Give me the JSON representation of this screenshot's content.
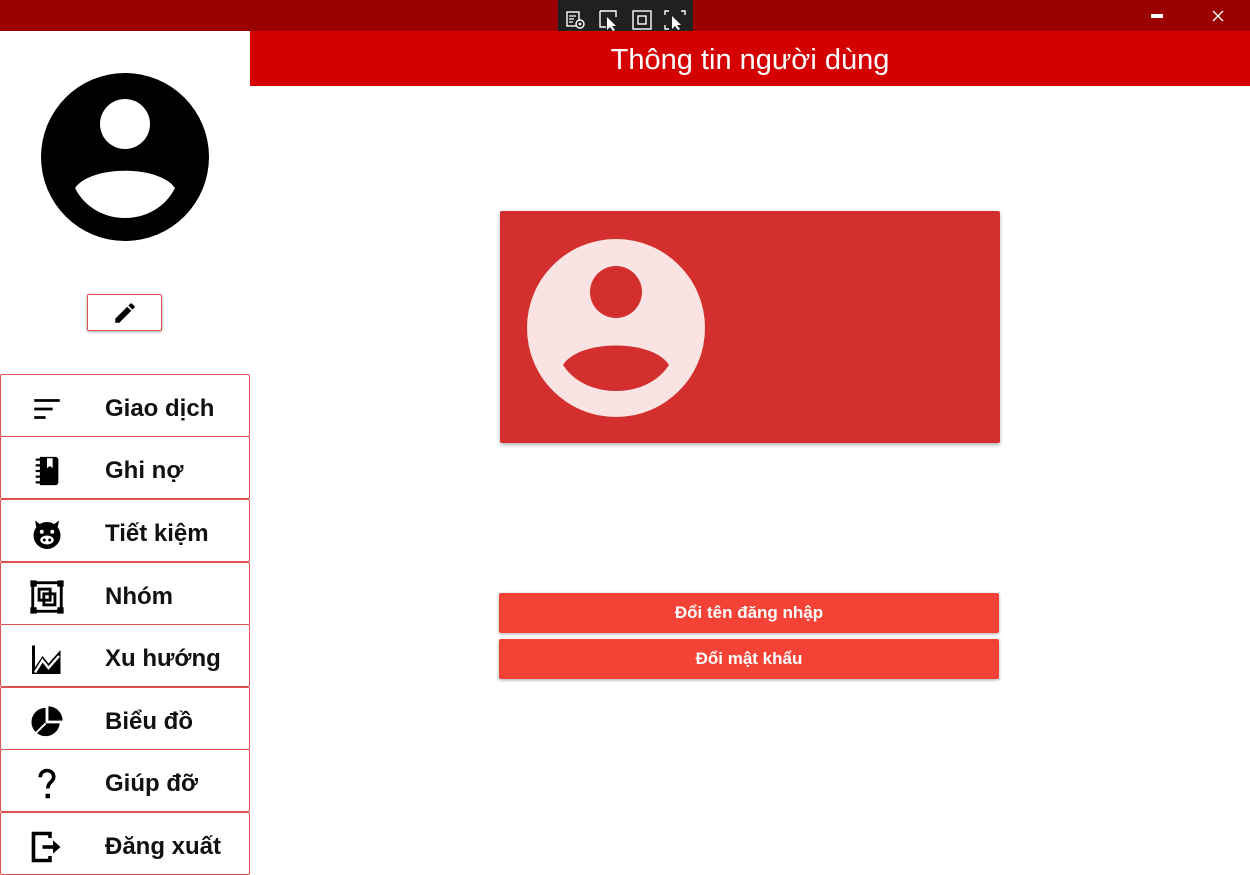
{
  "window": {
    "minimize_icon": "minimize-icon",
    "close_icon": "close-icon",
    "titlebar_color": "#9b0000"
  },
  "devtools": {
    "icons": [
      "live-visual-tree-icon",
      "select-element-icon",
      "display-adorners-icon",
      "track-focus-icon"
    ]
  },
  "header": {
    "title": "Thông tin người dùng",
    "color": "#d50000"
  },
  "sidebar": {
    "avatar_icon": "account-circle-icon",
    "edit_icon": "pencil-icon",
    "items": [
      {
        "label": "Giao dịch",
        "icon": "sort-lines-icon"
      },
      {
        "label": "Ghi nợ",
        "icon": "notebook-icon"
      },
      {
        "label": "Tiết kiệm",
        "icon": "piggy-bank-icon"
      },
      {
        "label": "Nhóm",
        "icon": "group-select-icon"
      },
      {
        "label": "Xu hướng",
        "icon": "chart-line-icon"
      },
      {
        "label": "Biểu đồ",
        "icon": "pie-chart-icon"
      },
      {
        "label": "Giúp đỡ",
        "icon": "help-icon"
      },
      {
        "label": "Đăng xuất",
        "icon": "logout-icon"
      }
    ],
    "border_color": "#e0504f"
  },
  "profile_card": {
    "avatar_icon": "account-circle-icon",
    "color": "#d32f2f"
  },
  "actions": {
    "change_username": "Đổi tên đăng nhập",
    "change_password": "Đổi mật khẩu",
    "color": "#f44336"
  }
}
